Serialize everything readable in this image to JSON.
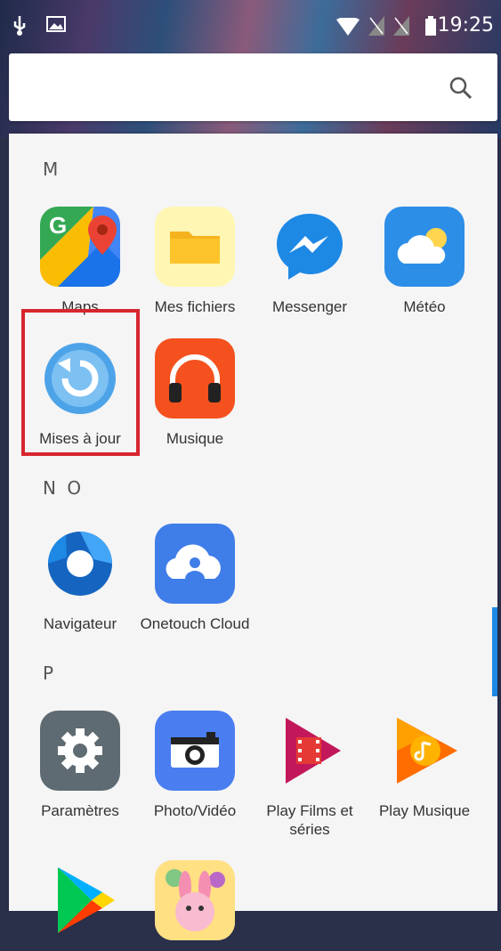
{
  "status_bar": {
    "time": "19:25",
    "icons": [
      "usb-icon",
      "image-notification-icon",
      "wifi-icon",
      "sim-empty-icon",
      "sim-empty-icon",
      "battery-icon"
    ]
  },
  "search": {
    "icon": "search-icon"
  },
  "sections": [
    {
      "letter": "M"
    },
    {
      "letter": "N O"
    },
    {
      "letter": "P"
    }
  ],
  "apps": [
    {
      "label": "Maps",
      "icon": "maps-icon"
    },
    {
      "label": "Mes fichiers",
      "icon": "folder-icon"
    },
    {
      "label": "Messenger",
      "icon": "messenger-icon"
    },
    {
      "label": "Météo",
      "icon": "weather-icon"
    },
    {
      "label": "Mises à jour",
      "icon": "update-icon"
    },
    {
      "label": "Musique",
      "icon": "headphones-icon"
    },
    {
      "label": "Navigateur",
      "icon": "browser-icon"
    },
    {
      "label": "Onetouch Cloud",
      "icon": "cloud-icon"
    },
    {
      "label": "Paramètres",
      "icon": "settings-gear-icon"
    },
    {
      "label": "Photo/Vidéo",
      "icon": "camera-icon"
    },
    {
      "label": "Play Films et séries",
      "icon": "play-films-icon"
    },
    {
      "label": "Play Musique",
      "icon": "play-music-icon"
    },
    {
      "label": "",
      "icon": "play-store-icon"
    },
    {
      "label": "",
      "icon": "game-bunny-icon"
    }
  ],
  "colors": {
    "highlight": "#d7262e",
    "scroll_indicator": "#1e88e5"
  }
}
